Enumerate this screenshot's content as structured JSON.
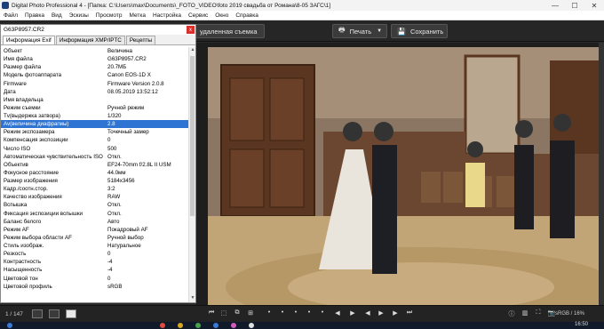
{
  "window": {
    "title": "Digital Photo Professional 4 - [Папка: C:\\Users\\max\\Documents\\_FOTO_VIDEO\\foto 2019 свадьба от Романа\\8-05 ЗАГС\\1]",
    "minimize": "—",
    "maximize": "☐",
    "close": "✕"
  },
  "menu": [
    "Файл",
    "Правка",
    "Вид",
    "Эскизы",
    "Просмотр",
    "Метка",
    "Настройка",
    "Сервис",
    "Окно",
    "Справка"
  ],
  "toolbar": {
    "remote_label": "удаленная съемка",
    "print_label": "Печать",
    "save_label": "Сохранить"
  },
  "info_panel": {
    "filename": "G63P8957.CR2",
    "close": "x",
    "tabs": [
      "Информация Exif",
      "Информация XMP/IPTC",
      "Рецепты"
    ],
    "selected_row": 9,
    "rows": [
      {
        "k": "Объект",
        "v": "Величина"
      },
      {
        "k": "Имя файла",
        "v": "G63P8957.CR2"
      },
      {
        "k": "Размер файла",
        "v": "20.7МБ"
      },
      {
        "k": "Модель фотоаппарата",
        "v": "Canon EOS-1D X"
      },
      {
        "k": "Firmware",
        "v": "Firmware Version 2.0.8"
      },
      {
        "k": "Дата",
        "v": "08.05.2019 13:52:12"
      },
      {
        "k": "Имя владельца",
        "v": ""
      },
      {
        "k": "Режим съемки",
        "v": "Ручной режим"
      },
      {
        "k": "Tv(выдержка затвора)",
        "v": "1/320"
      },
      {
        "k": "Av(величина диафрагмы)",
        "v": "2.8"
      },
      {
        "k": "Режим экспозамера",
        "v": "Точечный замер"
      },
      {
        "k": "Компенсация экспозиции",
        "v": "0"
      },
      {
        "k": "Число ISO",
        "v": "500"
      },
      {
        "k": "Автоматическая чувствительность ISO",
        "v": "Откл."
      },
      {
        "k": "Объектив",
        "v": "EF24-70mm f/2.8L II USM"
      },
      {
        "k": "Фокусное расстояние",
        "v": "44.0мм"
      },
      {
        "k": "Размер изображения",
        "v": "5184x3456"
      },
      {
        "k": "Кадр./соотн.стор.",
        "v": "3:2"
      },
      {
        "k": "Качество изображения",
        "v": "RAW"
      },
      {
        "k": "Вспышка",
        "v": "Откл."
      },
      {
        "k": "Фиксация экспозиции вспышки",
        "v": "Откл."
      },
      {
        "k": "Баланс белого",
        "v": "Авто"
      },
      {
        "k": "Режим AF",
        "v": "Покадровый AF"
      },
      {
        "k": "Режим выбора области AF",
        "v": "Ручной выбор"
      },
      {
        "k": "Стиль изображ.",
        "v": "Натуральное"
      },
      {
        "k": "Резкость",
        "v": "0"
      },
      {
        "k": "Контрастность",
        "v": "-4"
      },
      {
        "k": "Насыщенность",
        "v": "-4"
      },
      {
        "k": "Цветовой тон",
        "v": "0"
      },
      {
        "k": "Цветовой профиль",
        "v": "sRGB"
      }
    ]
  },
  "bottom": {
    "counter": "1 / 147",
    "color_space": "sRGB / 16%"
  },
  "taskbar": {
    "clock": "16:50"
  },
  "colors": {
    "selection": "#2e74d2",
    "close_red": "#d9302b",
    "toolbar_bg": "#262626"
  },
  "icons": {
    "print": "printer-icon",
    "save": "save-icon"
  }
}
